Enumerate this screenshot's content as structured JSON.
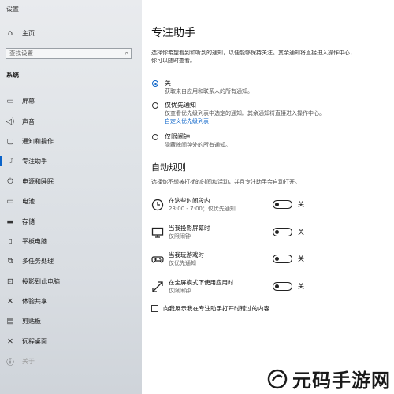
{
  "window": {
    "title": "设置"
  },
  "sidebar": {
    "home_label": "主页",
    "search_placeholder": "查找设置",
    "section": "系统",
    "items": [
      {
        "label": "屏幕",
        "icon": "monitor-icon"
      },
      {
        "label": "声音",
        "icon": "speaker-icon"
      },
      {
        "label": "通知和操作",
        "icon": "notification-icon"
      },
      {
        "label": "专注助手",
        "icon": "moon-icon",
        "active": true
      },
      {
        "label": "电源和睡眠",
        "icon": "power-icon"
      },
      {
        "label": "电池",
        "icon": "battery-icon"
      },
      {
        "label": "存储",
        "icon": "storage-icon"
      },
      {
        "label": "平板电脑",
        "icon": "tablet-icon"
      },
      {
        "label": "多任务处理",
        "icon": "multitask-icon"
      },
      {
        "label": "投影到此电脑",
        "icon": "project-icon"
      },
      {
        "label": "体验共享",
        "icon": "share-icon"
      },
      {
        "label": "剪贴板",
        "icon": "clipboard-icon"
      },
      {
        "label": "远程桌面",
        "icon": "remote-icon"
      },
      {
        "label": "关于",
        "icon": "info-icon"
      }
    ]
  },
  "main": {
    "title": "专注助手",
    "desc": "选择你希望看到和听到的通知，以便能够保持关注。其余通知将直接进入操作中心，你可以随时查看。",
    "options": [
      {
        "title": "关",
        "sub": "获取来自应用和联系人的所有通知。",
        "checked": true
      },
      {
        "title": "仅优先通知",
        "sub": "仅查看优先级列表中选定的通知。其余通知将直接进入操作中心。",
        "link": "自定义优先级列表",
        "checked": false
      },
      {
        "title": "仅限闹钟",
        "sub": "隐藏除闹钟外的所有通知。",
        "checked": false
      }
    ],
    "rules_title": "自动规则",
    "rules_desc": "选择你不想被打扰的时间和活动，并且专注助手会自动打开。",
    "rules": [
      {
        "title": "在这些时间段内",
        "sub": "23:00 - 7:00；仅优先通知",
        "icon": "clock-icon",
        "state": "关"
      },
      {
        "title": "当我投影屏幕时",
        "sub": "仅限闹钟",
        "icon": "display-icon",
        "state": "关"
      },
      {
        "title": "当我玩游戏时",
        "sub": "仅优先通知",
        "icon": "gamepad-icon",
        "state": "关"
      },
      {
        "title": "在全屏模式下使用应用时",
        "sub": "仅限闹钟",
        "icon": "fullscreen-icon",
        "state": "关"
      }
    ],
    "summary_checkbox": "向我展示我在专注助手打开时错过的内容"
  },
  "watermark": "元码手游网",
  "colors": {
    "accent": "#0a63c9"
  }
}
